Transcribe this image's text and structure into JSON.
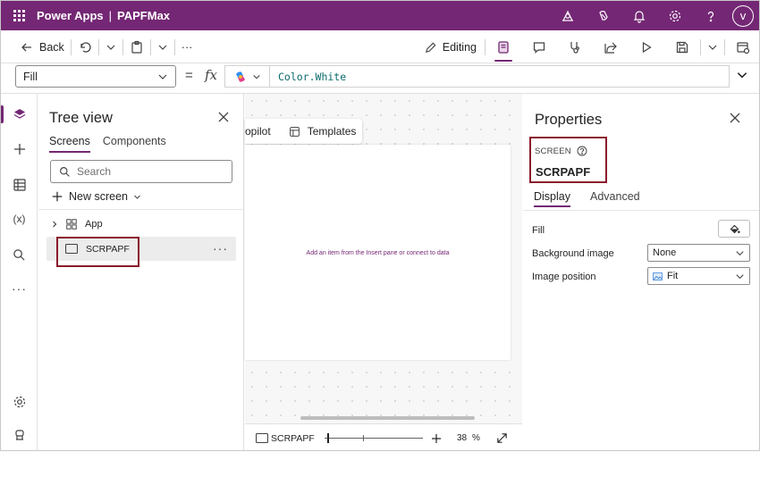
{
  "topbar": {
    "app_name": "Power Apps",
    "separator": "|",
    "project_name": "PAPFMax",
    "avatar_initial": "v",
    "brand_color": "#742774"
  },
  "commandbar": {
    "back_label": "Back",
    "more_label": "···",
    "editing_label": "Editing"
  },
  "formulabar": {
    "property": "Fill",
    "equals": "=",
    "fx": "fx",
    "formula": "Color.White"
  },
  "tree": {
    "title": "Tree view",
    "tabs": [
      "Screens",
      "Components"
    ],
    "search_placeholder": "Search",
    "new_screen_label": "New screen",
    "app_node": "App",
    "screen_node": "SCRPAPF",
    "more": "···"
  },
  "canvas": {
    "toolbar_copilot": "opilot",
    "toolbar_templates": "Templates",
    "empty_hint": "Add an item from the Insert pane or connect to data",
    "status_screen": "SCRPAPF",
    "zoom_value": "38",
    "zoom_unit": "%"
  },
  "properties": {
    "title": "Properties",
    "screen_label": "SCREEN",
    "screen_name": "SCRPAPF",
    "tabs": [
      "Display",
      "Advanced"
    ],
    "fill_label": "Fill",
    "background_image_label": "Background image",
    "background_image_value": "None",
    "image_position_label": "Image position",
    "image_position_value": "Fit"
  }
}
